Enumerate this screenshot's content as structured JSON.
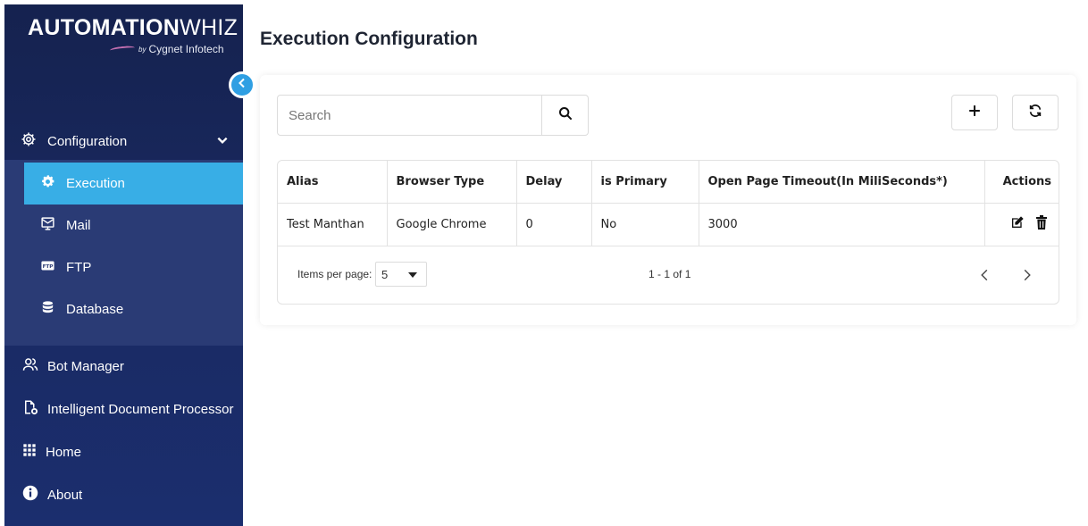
{
  "brand": {
    "name_bold": "AUTOMATION",
    "name_light": "WHIZ",
    "by": "by",
    "company": "Cygnet Infotech"
  },
  "sidebar": {
    "config_label": "Configuration",
    "sub_items": [
      {
        "label": "Execution",
        "icon": "gear-icon",
        "active": true
      },
      {
        "label": "Mail",
        "icon": "mail-monitor-icon"
      },
      {
        "label": "FTP",
        "icon": "ftp-icon"
      },
      {
        "label": "Database",
        "icon": "database-icon"
      }
    ],
    "items": [
      {
        "label": "Bot Manager",
        "icon": "users-icon"
      },
      {
        "label": "Intelligent Document Processor",
        "icon": "document-gear-icon"
      },
      {
        "label": "Home",
        "icon": "grid-icon"
      },
      {
        "label": "About",
        "icon": "info-icon"
      }
    ]
  },
  "page": {
    "title": "Execution Configuration"
  },
  "search": {
    "placeholder": "Search",
    "value": ""
  },
  "table": {
    "columns": [
      "Alias",
      "Browser Type",
      "Delay",
      "is Primary",
      "Open Page Timeout(In MiliSeconds*)",
      "Actions"
    ],
    "rows": [
      [
        "Test Manthan",
        "Google Chrome",
        "0",
        "No",
        "3000"
      ]
    ]
  },
  "paginator": {
    "items_per_page_label": "Items per page:",
    "page_size": "5",
    "range": "1 - 1 of 1"
  },
  "colors": {
    "sidebar": "#15224f",
    "submenu": "#2a3b75",
    "active": "#38aee6",
    "collapse": "#2f9fe3"
  }
}
